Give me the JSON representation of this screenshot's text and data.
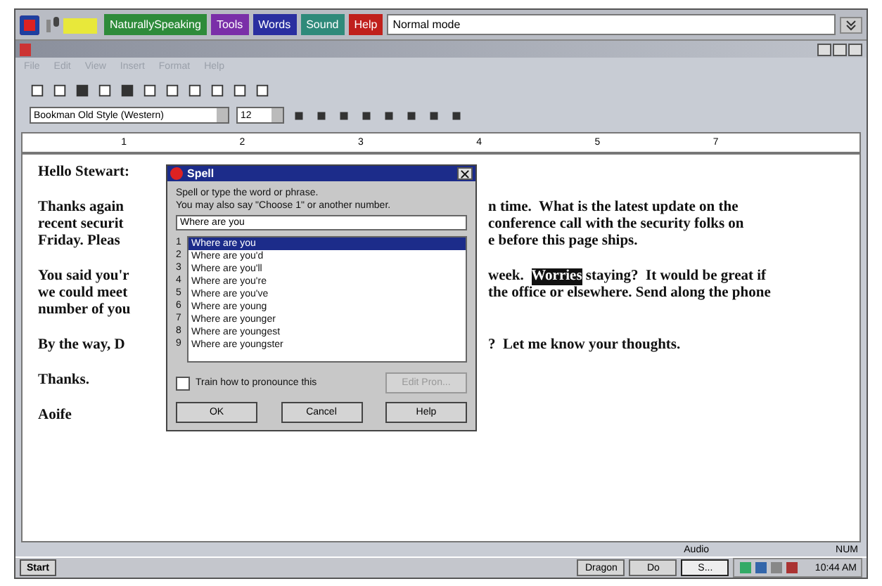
{
  "dragon_bar": {
    "menus": [
      {
        "label": "NaturallySpeaking",
        "color": "#2e8b3a"
      },
      {
        "label": "Tools",
        "color": "#7a2fa8"
      },
      {
        "label": "Words",
        "color": "#2a2fa0"
      },
      {
        "label": "Sound",
        "color": "#2f8a7a"
      },
      {
        "label": "Help",
        "color": "#c0201c"
      }
    ],
    "mode": "Normal mode"
  },
  "window": {
    "menu": [
      "File",
      "Edit",
      "View",
      "Insert",
      "Format",
      "Help"
    ]
  },
  "format_bar": {
    "font": "Bookman Old Style (Western)",
    "size": "12"
  },
  "ruler": {
    "numbers": [
      "1",
      "2",
      "3",
      "4",
      "5",
      "7"
    ]
  },
  "document": {
    "paragraphs": [
      {
        "lines": [
          {
            "left": "Hello Stewart:"
          }
        ]
      },
      {
        "lines": [
          {
            "left": "Thanks again",
            "right": [
              {
                "text": "n time.  What is the latest update on the",
                "selected": false
              }
            ]
          },
          {
            "left": "recent securit",
            "right": [
              {
                "text": "conference call with the security folks on",
                "selected": false
              }
            ]
          },
          {
            "left": "Friday.  Pleas",
            "right": [
              {
                "text": "e before this page ships.",
                "selected": false
              }
            ]
          }
        ]
      },
      {
        "lines": [
          {
            "left": "You said you'r",
            "right": [
              {
                "text": "week.  ",
                "selected": false
              },
              {
                "text": "Worries",
                "selected": true
              },
              {
                "text": " staying?  It would be great if",
                "selected": false
              }
            ]
          },
          {
            "left": "we could meet",
            "right": [
              {
                "text": "the office or elsewhere. Send along the phone",
                "selected": false
              }
            ]
          },
          {
            "left": "number of you"
          }
        ]
      },
      {
        "lines": [
          {
            "left": "By the way, D",
            "right": [
              {
                "text": "?  Let me know your thoughts.",
                "selected": false
              }
            ]
          }
        ]
      },
      {
        "lines": [
          {
            "left": "Thanks."
          }
        ]
      },
      {
        "lines": [
          {
            "left": "Aoife"
          }
        ]
      }
    ]
  },
  "spell_dialog": {
    "title": "Spell",
    "instructions": [
      "Spell or type the word or phrase.",
      "You may also say \"Choose 1\" or another number."
    ],
    "value": "Where are you",
    "choices": [
      {
        "number": "1",
        "text": "Where are you",
        "selected": true
      },
      {
        "number": "2",
        "text": "Where are you'd",
        "selected": false
      },
      {
        "number": "3",
        "text": "Where are you'll",
        "selected": false
      },
      {
        "number": "4",
        "text": "Where are you're",
        "selected": false
      },
      {
        "number": "5",
        "text": "Where are you've",
        "selected": false
      },
      {
        "number": "6",
        "text": "Where are young",
        "selected": false
      },
      {
        "number": "7",
        "text": "Where are younger",
        "selected": false
      },
      {
        "number": "8",
        "text": "Where are youngest",
        "selected": false
      },
      {
        "number": "9",
        "text": "Where are youngster",
        "selected": false
      }
    ],
    "train": {
      "label": "Train how to pronounce this",
      "checked": false
    },
    "buttons": [
      {
        "label": "Edit Pron...",
        "disabled": true
      },
      {
        "label": "OK",
        "disabled": false
      },
      {
        "label": "Cancel",
        "disabled": false
      },
      {
        "label": "Help",
        "disabled": false
      }
    ]
  },
  "status_bar": {
    "audio": "Audio",
    "num": "NUM"
  },
  "taskbar": {
    "start": "Start",
    "tasks": [
      {
        "label": "Dragon",
        "selected": false
      },
      {
        "label": "Do",
        "selected": false
      },
      {
        "label": "S...",
        "selected": true
      }
    ],
    "clock": "10:44 AM"
  }
}
